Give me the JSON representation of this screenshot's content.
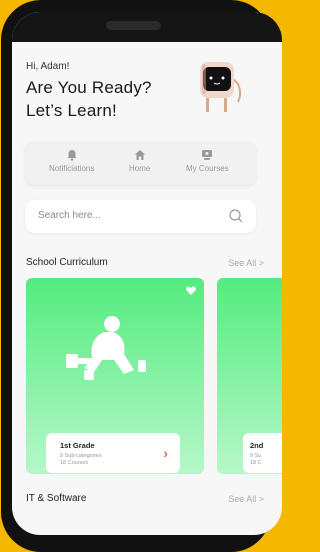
{
  "greeting": "Hi, Adam!",
  "headline_line1": "Are You Ready?",
  "headline_line2": "Let’s Learn!",
  "nav": [
    {
      "label": "Notificiations",
      "icon": "bell-icon"
    },
    {
      "label": "Home",
      "icon": "home-icon"
    },
    {
      "label": "My Courses",
      "icon": "courses-icon"
    }
  ],
  "search": {
    "placeholder": "Search here..."
  },
  "sections": [
    {
      "title": "School Curriculum",
      "see_all": "See All >"
    },
    {
      "title": "IT & Software",
      "see_all": "See All >"
    }
  ],
  "cards": [
    {
      "title": "1st Grade",
      "subcategories": "9 Sub-categories",
      "courses": "18 Courses"
    },
    {
      "title": "2nd",
      "subcategories": "9 Su",
      "courses": "18 C"
    }
  ],
  "colors": {
    "background": "#f5b800",
    "card_green": "#54ec7f",
    "arrow": "#e06b50"
  }
}
